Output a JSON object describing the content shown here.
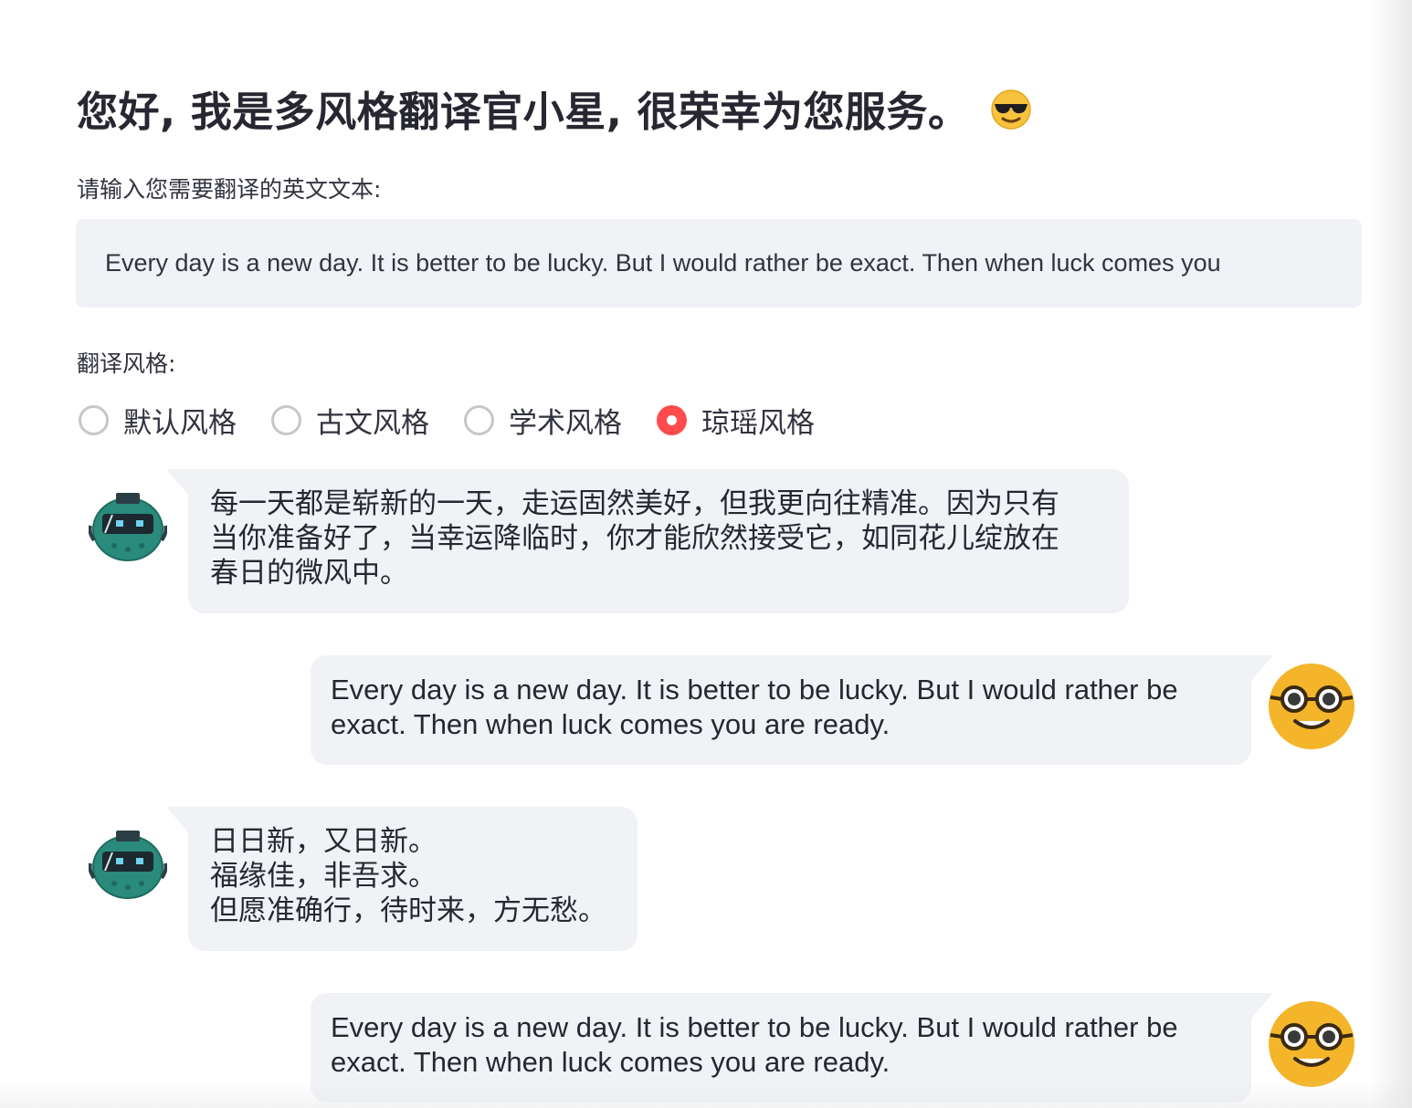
{
  "header": {
    "title": "您好, 我是多风格翻译官小星, 很荣幸为您服务。",
    "title_emoji": "sunglasses-face-icon"
  },
  "input": {
    "label": "请输入您需要翻译的英文文本:",
    "value": "Every day is a new day. It is better to be lucky. But I would rather be exact. Then when luck comes you"
  },
  "style": {
    "label": "翻译风格:",
    "options": [
      "默认风格",
      "古文风格",
      "学术风格",
      "琼瑶风格"
    ],
    "selected": "琼瑶风格",
    "accent_color": "#ff4b4b"
  },
  "chat": {
    "messages": [
      {
        "role": "assistant",
        "avatar": "robot-avatar-icon",
        "lines": [
          "每一天都是崭新的一天，走运固然美好，但我更向往精准。因为只有",
          "当你准备好了，当幸运降临时，你才能欣然接受它，如同花儿绽放在",
          "春日的微风中。"
        ]
      },
      {
        "role": "user",
        "avatar": "nerd-face-avatar-icon",
        "lines": [
          "Every day is a new day. It is better to be lucky. But I would rather be",
          "exact. Then when luck comes you are ready."
        ]
      },
      {
        "role": "assistant",
        "avatar": "robot-avatar-icon",
        "lines": [
          "日日新，又日新。",
          "福缘佳，非吾求。",
          "但愿准确行，待时来，方无愁。"
        ]
      },
      {
        "role": "user",
        "avatar": "nerd-face-avatar-icon",
        "lines": [
          "Every day is a new day. It is better to be lucky. But I would rather be",
          "exact. Then when luck comes you are ready."
        ]
      }
    ]
  },
  "colors": {
    "bubble_bg": "#f0f2f6",
    "text": "#31333f",
    "robot": "#2a8a7c",
    "user_avatar": "#f4b52b"
  }
}
